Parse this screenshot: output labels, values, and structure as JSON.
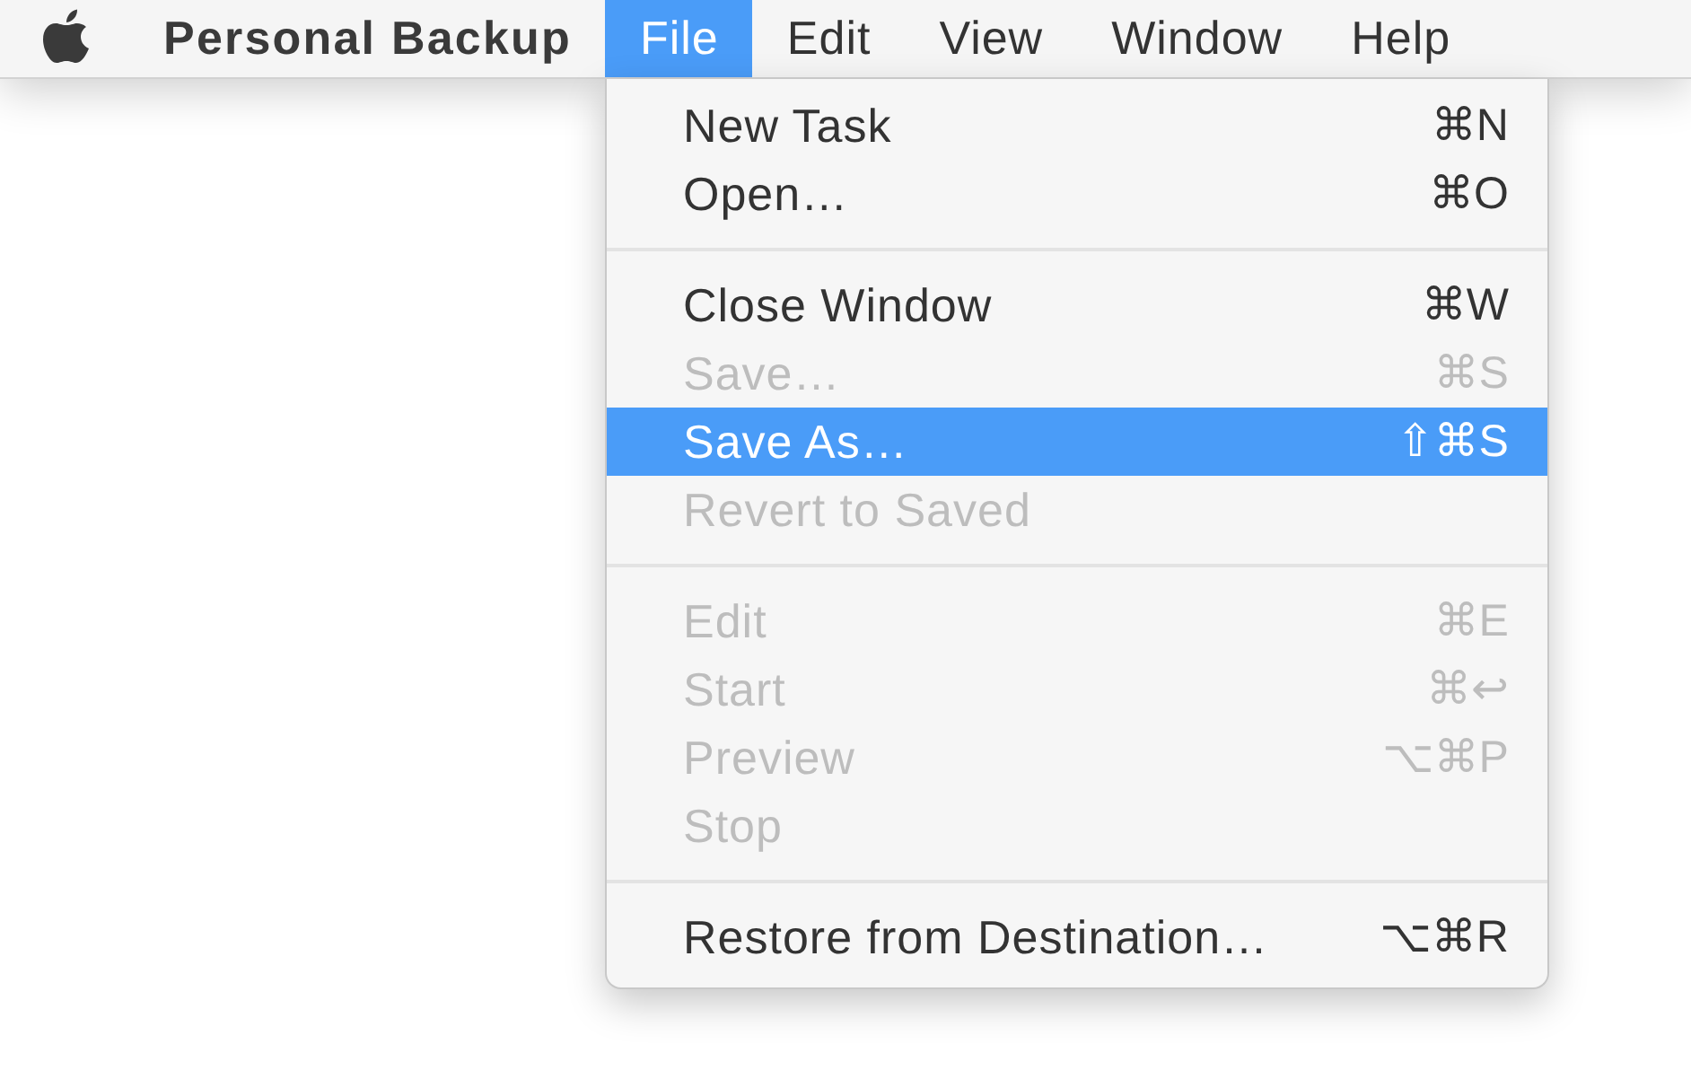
{
  "menubar": {
    "app_name": "Personal Backup",
    "menus": [
      {
        "label": "File",
        "selected": true
      },
      {
        "label": "Edit",
        "selected": false
      },
      {
        "label": "View",
        "selected": false
      },
      {
        "label": "Window",
        "selected": false
      },
      {
        "label": "Help",
        "selected": false
      }
    ]
  },
  "dropdown": {
    "sections": [
      {
        "items": [
          {
            "label": "New Task",
            "shortcut": "⌘N",
            "disabled": false,
            "selected": false
          },
          {
            "label": "Open…",
            "shortcut": "⌘O",
            "disabled": false,
            "selected": false
          }
        ]
      },
      {
        "items": [
          {
            "label": "Close Window",
            "shortcut": "⌘W",
            "disabled": false,
            "selected": false
          },
          {
            "label": "Save…",
            "shortcut": "⌘S",
            "disabled": true,
            "selected": false
          },
          {
            "label": "Save As…",
            "shortcut": "⇧⌘S",
            "disabled": false,
            "selected": true
          },
          {
            "label": "Revert to Saved",
            "disabled": true,
            "selected": false
          }
        ]
      },
      {
        "items": [
          {
            "label": "Edit",
            "shortcut": "⌘E",
            "disabled": true,
            "selected": false
          },
          {
            "label": "Start",
            "shortcut": "⌘↩",
            "disabled": true,
            "selected": false
          },
          {
            "label": "Preview",
            "shortcut": "⌥⌘P",
            "disabled": true,
            "selected": false
          },
          {
            "label": "Stop",
            "disabled": true,
            "selected": false
          }
        ]
      },
      {
        "items": [
          {
            "label": "Restore from Destination…",
            "shortcut": "⌥⌘R",
            "disabled": false,
            "selected": false
          }
        ]
      }
    ]
  }
}
